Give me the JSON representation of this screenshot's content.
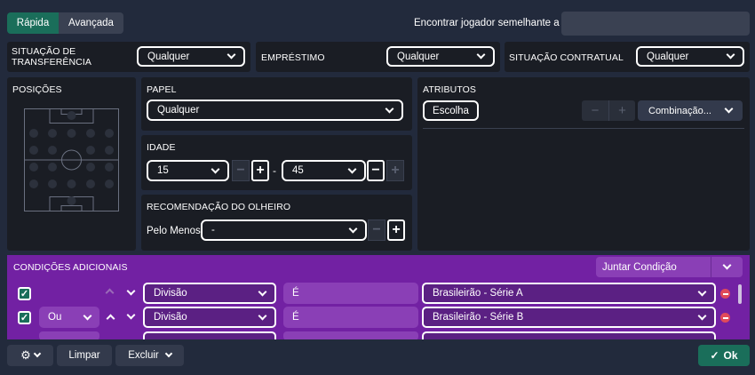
{
  "tabs": {
    "quick": "Rápida",
    "advanced": "Avançada"
  },
  "find_similar": {
    "label": "Encontrar jogador semelhante a",
    "value": ""
  },
  "filters": {
    "transfer_status": {
      "label": "SITUAÇÃO DE TRANSFERÊNCIA",
      "value": "Qualquer"
    },
    "loan": {
      "label": "EMPRÉSTIMO",
      "value": "Qualquer"
    },
    "contract_status": {
      "label": "SITUAÇÃO CONTRATUAL",
      "value": "Qualquer"
    }
  },
  "positions": {
    "label": "POSIÇÕES"
  },
  "role": {
    "label": "PAPEL",
    "value": "Qualquer"
  },
  "age": {
    "label": "IDADE",
    "min": "15",
    "max": "45",
    "separator": "-"
  },
  "scout": {
    "label": "RECOMENDAÇÃO DO OLHEIRO",
    "prefix": "Pelo Menos",
    "value": "-"
  },
  "attributes": {
    "label": "ATRIBUTOS",
    "choose": "Escolha",
    "combination": "Combinação..."
  },
  "conditions": {
    "label": "CONDIÇÕES ADICIONAIS",
    "join": "Juntar Condição",
    "rows": [
      {
        "connector": "",
        "field": "Divisão",
        "op": "É",
        "value": "Brasileirão - Série A"
      },
      {
        "connector": "Ou",
        "field": "Divisão",
        "op": "É",
        "value": "Brasileirão - Série B"
      }
    ]
  },
  "footer": {
    "clear": "Limpar",
    "exclude": "Excluir",
    "ok": "Ok"
  },
  "colors": {
    "accent_green": "#1a6e5a",
    "purple": "#7221a3",
    "background": "#222a3c",
    "panel": "#1a1d24",
    "remove_red": "#e04a5a"
  }
}
